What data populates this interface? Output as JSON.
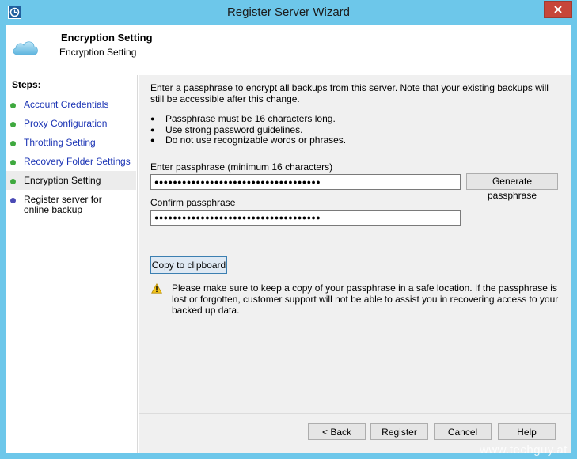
{
  "window": {
    "title": "Register Server Wizard",
    "close_label": "X"
  },
  "header": {
    "title": "Encryption Setting",
    "subtitle": "Encryption Setting"
  },
  "sidebar": {
    "steps_title": "Steps:",
    "steps": [
      {
        "label": "Account Credentials",
        "state": "done"
      },
      {
        "label": "Proxy Configuration",
        "state": "done"
      },
      {
        "label": "Throttling Setting",
        "state": "done"
      },
      {
        "label": "Recovery Folder Settings",
        "state": "done"
      },
      {
        "label": "Encryption Setting",
        "state": "active"
      },
      {
        "label": "Register server for online backup",
        "state": "pending"
      }
    ]
  },
  "main": {
    "intro": "Enter a passphrase to encrypt all backups from this server. Note that your existing backups will still be accessible after this change.",
    "bullets": [
      "Passphrase must be 16 characters long.",
      "Use strong password guidelines.",
      "Do not use recognizable words or phrases."
    ],
    "passphrase_label": "Enter passphrase (minimum 16 characters)",
    "passphrase_value": "●●●●●●●●●●●●●●●●●●●●●●●●●●●●●●●●●●●●",
    "generate_label": "Generate passphrase",
    "confirm_label": "Confirm passphrase",
    "confirm_value": "●●●●●●●●●●●●●●●●●●●●●●●●●●●●●●●●●●●●",
    "copy_label": "Copy to clipboard",
    "warning": "Please make sure to keep a copy of your passphrase in a safe location. If the passphrase is lost or forgotten, customer support will not be able to assist you in recovering access to your backed up data."
  },
  "footer": {
    "back_label": "< Back",
    "register_label": "Register",
    "cancel_label": "Cancel",
    "help_label": "Help"
  },
  "watermark": "www.techguy.at",
  "colors": {
    "title_bar": "#6dc7ea",
    "close_button": "#c7463a",
    "link": "#1a33b4",
    "step_done": "#3fa93f",
    "step_pending": "#4a4ab5",
    "content_bg": "#f0f0f0"
  },
  "icons": {
    "app": "backup-clock-icon",
    "header": "cloud-icon",
    "warning": "warning-icon"
  }
}
